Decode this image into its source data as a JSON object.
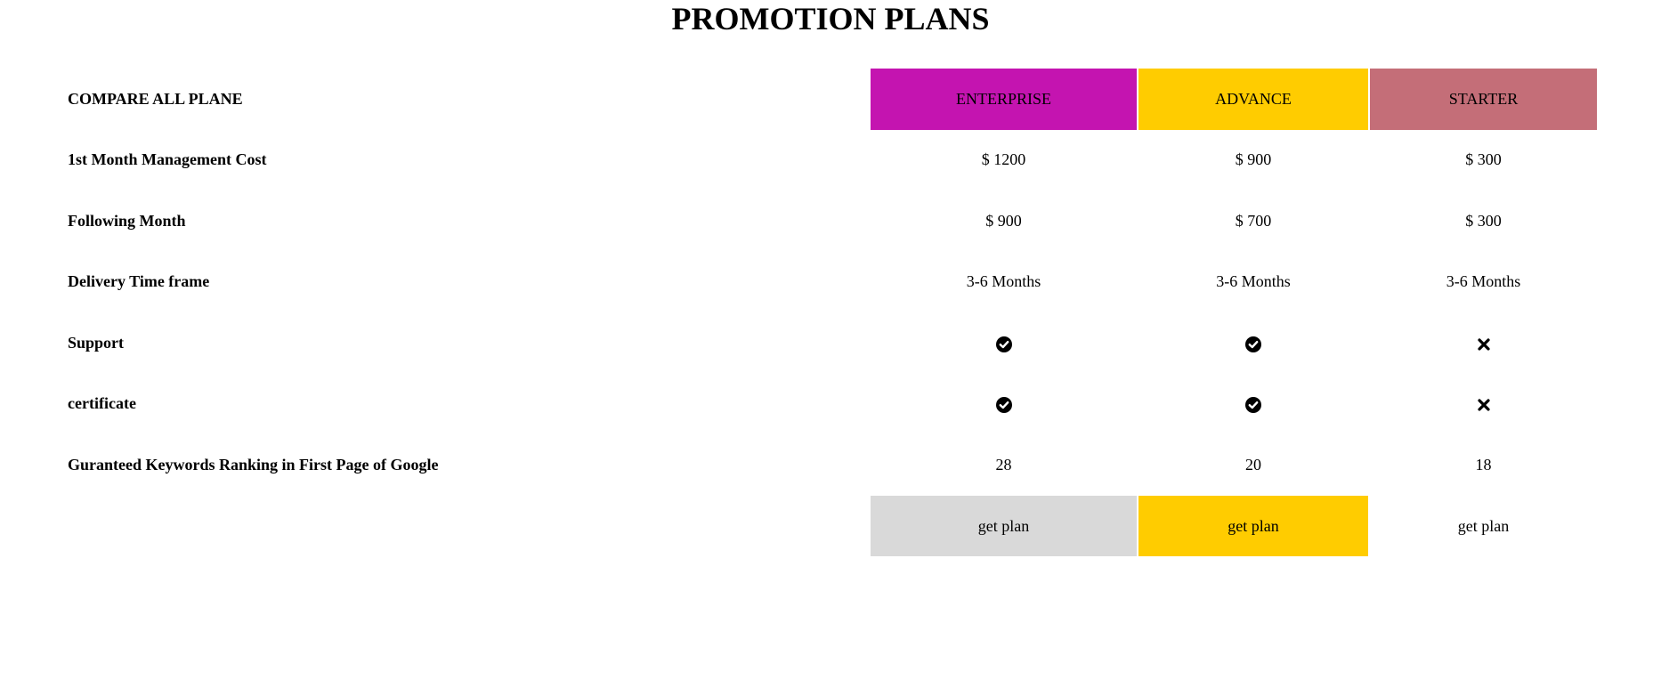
{
  "page": {
    "title": "PROMOTION PLANS"
  },
  "table": {
    "corner_label": "COMPARE ALL PLANE",
    "plans": [
      {
        "name": "ENTERPRISE",
        "color": "#c414b0"
      },
      {
        "name": "ADVANCE",
        "color": "#ffcc00"
      },
      {
        "name": "STARTER",
        "color": "#c46e78"
      }
    ],
    "rows": [
      {
        "label": "1st Month Management Cost",
        "values": [
          "$ 1200",
          "$ 900",
          "$ 300"
        ]
      },
      {
        "label": "Following Month",
        "values": [
          "$ 900",
          "$ 700",
          "$ 300"
        ]
      },
      {
        "label": "Delivery Time frame",
        "values": [
          "3-6 Months",
          "3-6 Months",
          "3-6 Months"
        ]
      },
      {
        "label": "Support",
        "icons": [
          "check-circle-icon",
          "check-circle-icon",
          "x-icon"
        ]
      },
      {
        "label": "certificate",
        "icons": [
          "check-circle-icon",
          "check-circle-icon",
          "x-icon"
        ]
      },
      {
        "label": "Guranteed Keywords Ranking in First Page of Google",
        "values": [
          "28",
          "20",
          "18"
        ]
      }
    ],
    "buttons": [
      {
        "label": "get plan",
        "color": "#d9d9d9"
      },
      {
        "label": "get plan",
        "color": "#ffcc00"
      },
      {
        "label": "get plan",
        "color": "#ffffff"
      }
    ]
  }
}
